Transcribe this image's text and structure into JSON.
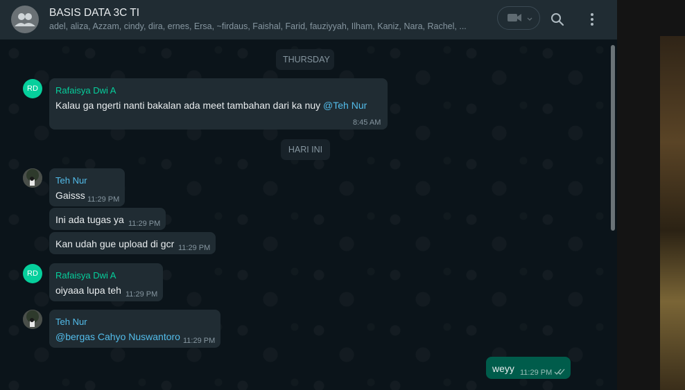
{
  "header": {
    "group_name": "BASIS DATA 3C TI",
    "members": "adel, aliza, Azzam, cindy, dira, ernes, Ersa, ~firdaus, Faishal, Farid, fauziyyah, Ilham, Kaniz, Nara, Rachel, ...",
    "icons": [
      "group-avatar-icon",
      "video-camera-icon",
      "chevron-down-icon",
      "search-icon",
      "menu-dots-icon"
    ]
  },
  "chat": {
    "date_thursday": "THURSDAY",
    "date_today": "HARI INI",
    "messages": [
      {
        "sender": "Rafaisya Dwi A",
        "avatar": "RD",
        "text": "Kalau ga ngerti nanti bakalan ada meet tambahan dari ka nuy ",
        "mention": "@Teh Nur",
        "time": "8:45 AM"
      },
      {
        "sender": "Teh Nur",
        "text": "Gaisss",
        "time": "11:29 PM"
      },
      {
        "text": "Ini ada tugas ya",
        "time": "11:29 PM"
      },
      {
        "text": "Kan udah gue upload di gcr",
        "time": "11:29 PM"
      },
      {
        "sender": "Rafaisya Dwi A",
        "avatar": "RD",
        "text": "oiyaaa lupa teh",
        "time": "11:29 PM"
      },
      {
        "sender": "Teh Nur",
        "mention": "@bergas Cahyo Nuswantoro",
        "time": "11:29 PM"
      },
      {
        "text": "weyy",
        "time": "11:29 PM",
        "status": "read-double-check-icon"
      }
    ]
  },
  "colors": {
    "header_bg": "#202c33",
    "chat_bg": "#0b141a",
    "incoming_bubble": "#202c33",
    "outgoing_bubble": "#005c4b",
    "sender_teal": "#06cf9c",
    "mention_blue": "#53bdeb"
  }
}
